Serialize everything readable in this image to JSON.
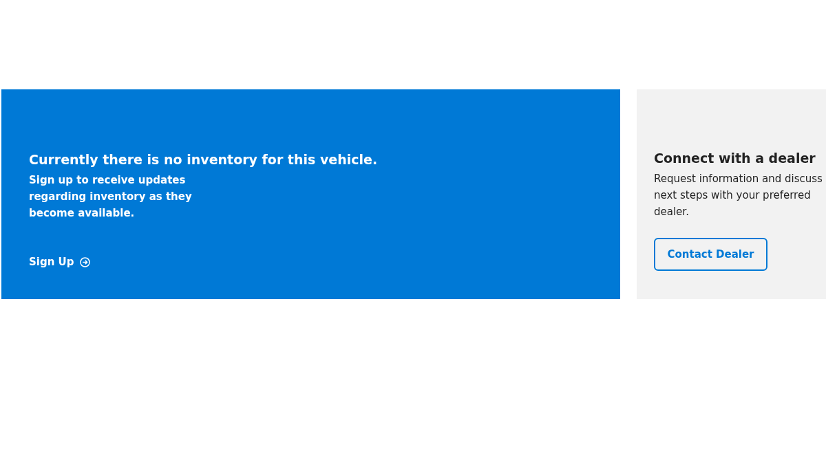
{
  "inventory_banner": {
    "heading": "Currently there is no inventory for this vehicle.",
    "text": "Sign up to receive updates regarding inventory as they become available.",
    "link": "Sign Up"
  },
  "dealer_panel": {
    "heading": "Connect with a dealer",
    "text": "Request information and discuss next steps with your preferred dealer.",
    "button": "Contact Dealer"
  }
}
